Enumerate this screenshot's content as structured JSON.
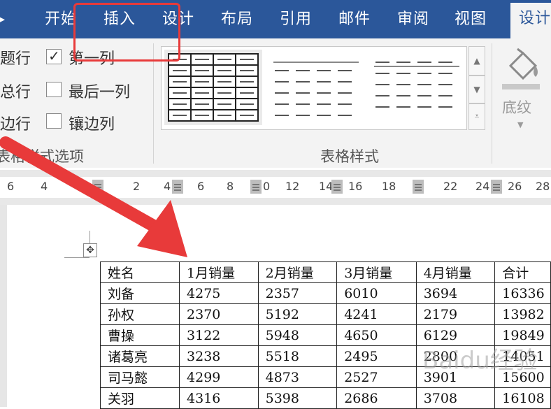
{
  "ribbon": {
    "tabs": [
      {
        "label": "开始"
      },
      {
        "label": "插入"
      },
      {
        "label": "设计"
      },
      {
        "label": "布局"
      },
      {
        "label": "引用"
      },
      {
        "label": "邮件"
      },
      {
        "label": "审阅"
      },
      {
        "label": "视图"
      },
      {
        "label": "设计"
      }
    ],
    "active_tab_index": 8,
    "colors": {
      "tab_bar": "#2b579a",
      "ribbon_bg": "#f3f3f3",
      "annotation": "#e83a3a"
    }
  },
  "style_options": {
    "items": [
      {
        "label": "题行"
      },
      {
        "label": "第一列",
        "checked": true
      },
      {
        "label": "总行"
      },
      {
        "label": "最后一列",
        "checked": false
      },
      {
        "label": "边行"
      },
      {
        "label": "镶边列",
        "checked": false
      }
    ],
    "group_label": "表格样式选项"
  },
  "table_styles": {
    "group_label": "表格样式"
  },
  "shading": {
    "label": "底纹",
    "icon": "paint-bucket-icon"
  },
  "ruler": {
    "ticks": [
      "6",
      "4",
      "2",
      "4",
      "6",
      "8",
      "0",
      "12",
      "14",
      "16",
      "18",
      "22",
      "24",
      "26",
      "28"
    ]
  },
  "table": {
    "headers": [
      "姓名",
      "1月销量",
      "2月销量",
      "3月销量",
      "4月销量",
      "合计"
    ],
    "rows": [
      [
        "刘备",
        "4275",
        "2357",
        "6010",
        "3694",
        "16336"
      ],
      [
        "孙权",
        "2370",
        "5192",
        "4241",
        "2179",
        "13982"
      ],
      [
        "曹操",
        "3122",
        "5948",
        "4650",
        "6129",
        "19849"
      ],
      [
        "诸葛亮",
        "3238",
        "5518",
        "2495",
        "2800",
        "14051"
      ],
      [
        "司马懿",
        "4299",
        "4873",
        "2527",
        "3901",
        "15600"
      ],
      [
        "关羽",
        "4316",
        "5398",
        "2686",
        "3708",
        "16108"
      ]
    ]
  },
  "watermark": "Baidu经验"
}
